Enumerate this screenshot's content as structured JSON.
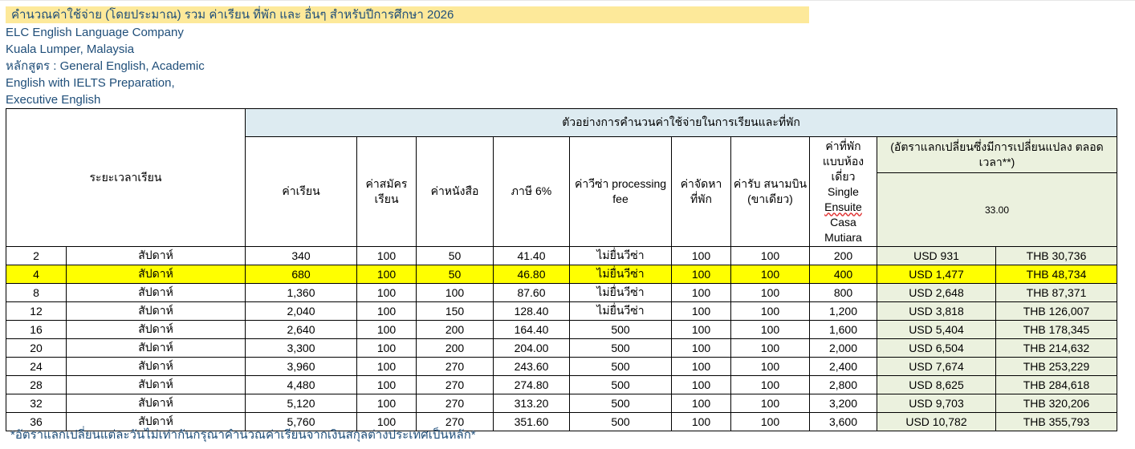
{
  "header": {
    "title": "คำนวณค่าใช้จ่าย  (โดยประมาณ) รวม ค่าเรียน ที่พัก และ อื่นๆ สำหรับปีการศึกษา 2026",
    "school": "ELC English Language Company",
    "location": "Kuala Lumper, Malaysia",
    "course_line1": "หลักสูตร : General English, Academic",
    "course_line2": "English with IELTS Preparation,",
    "course_line3": "Executive English"
  },
  "table": {
    "col_duration": "ระยะเวลาเรียน",
    "span_title": "ตัวอย่างการคำนวนค่าใช้จ่ายในการเรียนและที่พัก",
    "col_tuition": "ค่าเรียน",
    "col_registration": "ค่าสมัคร\nเรียน",
    "col_books": "ค่าหนังสือ",
    "col_tax": "ภาษี 6%",
    "col_visa": "ค่าวีซ่า\nprocessing fee",
    "col_placement": "ค่าจัดหา\nที่พัก",
    "col_airport": "ค่ารับ\nสนามบิน\n(ขาเดียว)",
    "col_accom_1": "ค่าที่พัก\nแบบห้อง\nเดี่ยว\nSingle",
    "col_accom_2": "Ensuite",
    "col_accom_3": "Casa\nMutiara",
    "fx_note": "(อัตราแลกเปลี่ยนซึ่งมีการเปลี่ยนแปลง\nตลอดเวลา**)",
    "fx_rate": "33.00",
    "rows": [
      {
        "weeks": "2",
        "unit": "สัปดาห์",
        "tuition": "340",
        "registration": "100",
        "books": "50",
        "tax": "41.40",
        "visa": "ไม่ยื่นวีซ่า",
        "placement": "100",
        "airport": "100",
        "accommodation": "200",
        "usd": "USD 931",
        "thb": "THB 30,736"
      },
      {
        "weeks": "4",
        "unit": "สัปดาห์",
        "tuition": "680",
        "registration": "100",
        "books": "50",
        "tax": "46.80",
        "visa": "ไม่ยื่นวีซ่า",
        "placement": "100",
        "airport": "100",
        "accommodation": "400",
        "usd": "USD 1,477",
        "thb": "THB 48,734"
      },
      {
        "weeks": "8",
        "unit": "สัปดาห์",
        "tuition": "1,360",
        "registration": "100",
        "books": "100",
        "tax": "87.60",
        "visa": "ไม่ยื่นวีซ่า",
        "placement": "100",
        "airport": "100",
        "accommodation": "800",
        "usd": "USD 2,648",
        "thb": "THB 87,371"
      },
      {
        "weeks": "12",
        "unit": "สัปดาห์",
        "tuition": "2,040",
        "registration": "100",
        "books": "150",
        "tax": "128.40",
        "visa": "ไม่ยื่นวีซ่า",
        "placement": "100",
        "airport": "100",
        "accommodation": "1,200",
        "usd": "USD 3,818",
        "thb": "THB 126,007"
      },
      {
        "weeks": "16",
        "unit": "สัปดาห์",
        "tuition": "2,640",
        "registration": "100",
        "books": "200",
        "tax": "164.40",
        "visa": "500",
        "placement": "100",
        "airport": "100",
        "accommodation": "1,600",
        "usd": "USD 5,404",
        "thb": "THB 178,345"
      },
      {
        "weeks": "20",
        "unit": "สัปดาห์",
        "tuition": "3,300",
        "registration": "100",
        "books": "200",
        "tax": "204.00",
        "visa": "500",
        "placement": "100",
        "airport": "100",
        "accommodation": "2,000",
        "usd": "USD 6,504",
        "thb": "THB 214,632"
      },
      {
        "weeks": "24",
        "unit": "สัปดาห์",
        "tuition": "3,960",
        "registration": "100",
        "books": "270",
        "tax": "243.60",
        "visa": "500",
        "placement": "100",
        "airport": "100",
        "accommodation": "2,400",
        "usd": "USD 7,674",
        "thb": "THB 253,229"
      },
      {
        "weeks": "28",
        "unit": "สัปดาห์",
        "tuition": "4,480",
        "registration": "100",
        "books": "270",
        "tax": "274.80",
        "visa": "500",
        "placement": "100",
        "airport": "100",
        "accommodation": "2,800",
        "usd": "USD 8,625",
        "thb": "THB 284,618"
      },
      {
        "weeks": "32",
        "unit": "สัปดาห์",
        "tuition": "5,120",
        "registration": "100",
        "books": "270",
        "tax": "313.20",
        "visa": "500",
        "placement": "100",
        "airport": "100",
        "accommodation": "3,200",
        "usd": "USD 9,703",
        "thb": "THB 320,206"
      },
      {
        "weeks": "36",
        "unit": "สัปดาห์",
        "tuition": "5,760",
        "registration": "100",
        "books": "270",
        "tax": "351.60",
        "visa": "500",
        "placement": "100",
        "airport": "100",
        "accommodation": "3,600",
        "usd": "USD 10,782",
        "thb": "THB 355,793"
      }
    ],
    "highlight_color": "#ffff00",
    "fx_fill_color": "#ebf1de",
    "span_fill_color": "#ddebf1"
  },
  "footnote": "*อัตราแลกเปลี่ยนแต่ละวันไม่เท่ากันกรุณาคำนวณค่าเรียนจากเงินสกุลต่างประเทศเป็นหลัก*"
}
